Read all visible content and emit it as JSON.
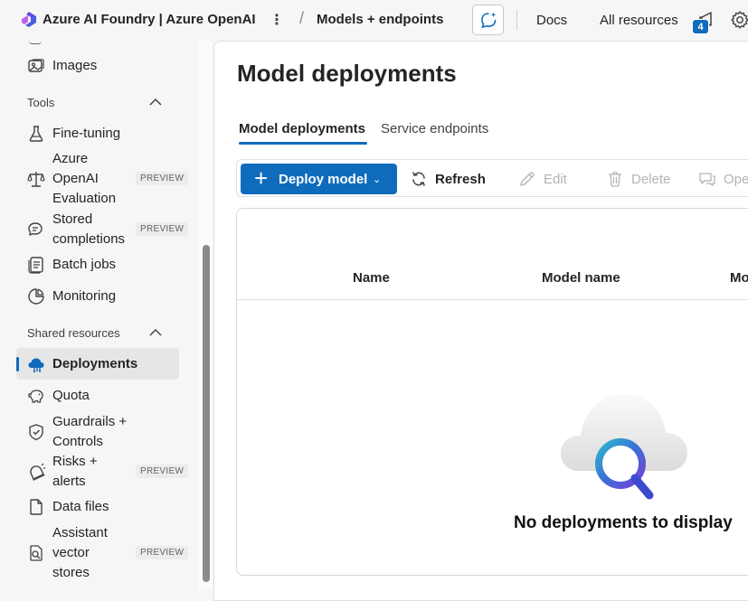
{
  "header": {
    "app_title": "Azure AI Foundry | Azure OpenAI",
    "more_label": "⋮",
    "breadcrumb_sep": "/",
    "breadcrumb": "Models + endpoints",
    "links": {
      "docs": "Docs",
      "all_resources": "All resources"
    },
    "notification_count": "4"
  },
  "sidebar": {
    "items_top": [
      {
        "label": "Images",
        "icon": "images-icon"
      }
    ],
    "sections": {
      "tools": "Tools",
      "shared_resources": "Shared resources"
    },
    "tools_items": [
      {
        "label": "Fine-tuning",
        "icon": "flask-icon"
      },
      {
        "label": "Azure OpenAI Evaluation",
        "line1": "Azure",
        "line2": "OpenAI",
        "line3": "Evaluation",
        "icon": "scales-icon",
        "badge": "PREVIEW"
      },
      {
        "label": "Stored completions",
        "line1": "Stored",
        "line2": "completions",
        "icon": "chat-bubbles-icon",
        "badge": "PREVIEW"
      },
      {
        "label": "Batch jobs",
        "icon": "batch-icon"
      },
      {
        "label": "Monitoring",
        "icon": "monitoring-icon"
      }
    ],
    "shared_items": [
      {
        "label": "Deployments",
        "icon": "deployments-icon",
        "active": true
      },
      {
        "label": "Quota",
        "icon": "piggy-bank-icon"
      },
      {
        "label": "Guardrails + Controls",
        "line1": "Guardrails +",
        "line2": "Controls",
        "icon": "shield-icon"
      },
      {
        "label": "Risks + alerts",
        "line1": "Risks +",
        "line2": "alerts",
        "icon": "alert-icon",
        "badge": "PREVIEW"
      },
      {
        "label": "Data files",
        "icon": "document-icon"
      },
      {
        "label": "Assistant vector stores",
        "line1": "Assistant",
        "line2": "vector",
        "line3": "stores",
        "icon": "vector-search-icon",
        "badge": "PREVIEW"
      }
    ]
  },
  "main": {
    "title": "Model deployments",
    "tabs": [
      {
        "label": "Model deployments",
        "active": true
      },
      {
        "label": "Service endpoints",
        "active": false
      }
    ],
    "toolbar": {
      "deploy": "Deploy model",
      "refresh": "Refresh",
      "edit": "Edit",
      "delete": "Delete",
      "open": "Ope"
    },
    "table": {
      "columns": [
        "Name",
        "Model name",
        "Mo"
      ],
      "rows": [],
      "empty_message": "No deployments to display"
    }
  },
  "colors": {
    "accent": "#0f6cbd",
    "background": "#f6f6f6",
    "panel": "#ffffff"
  }
}
